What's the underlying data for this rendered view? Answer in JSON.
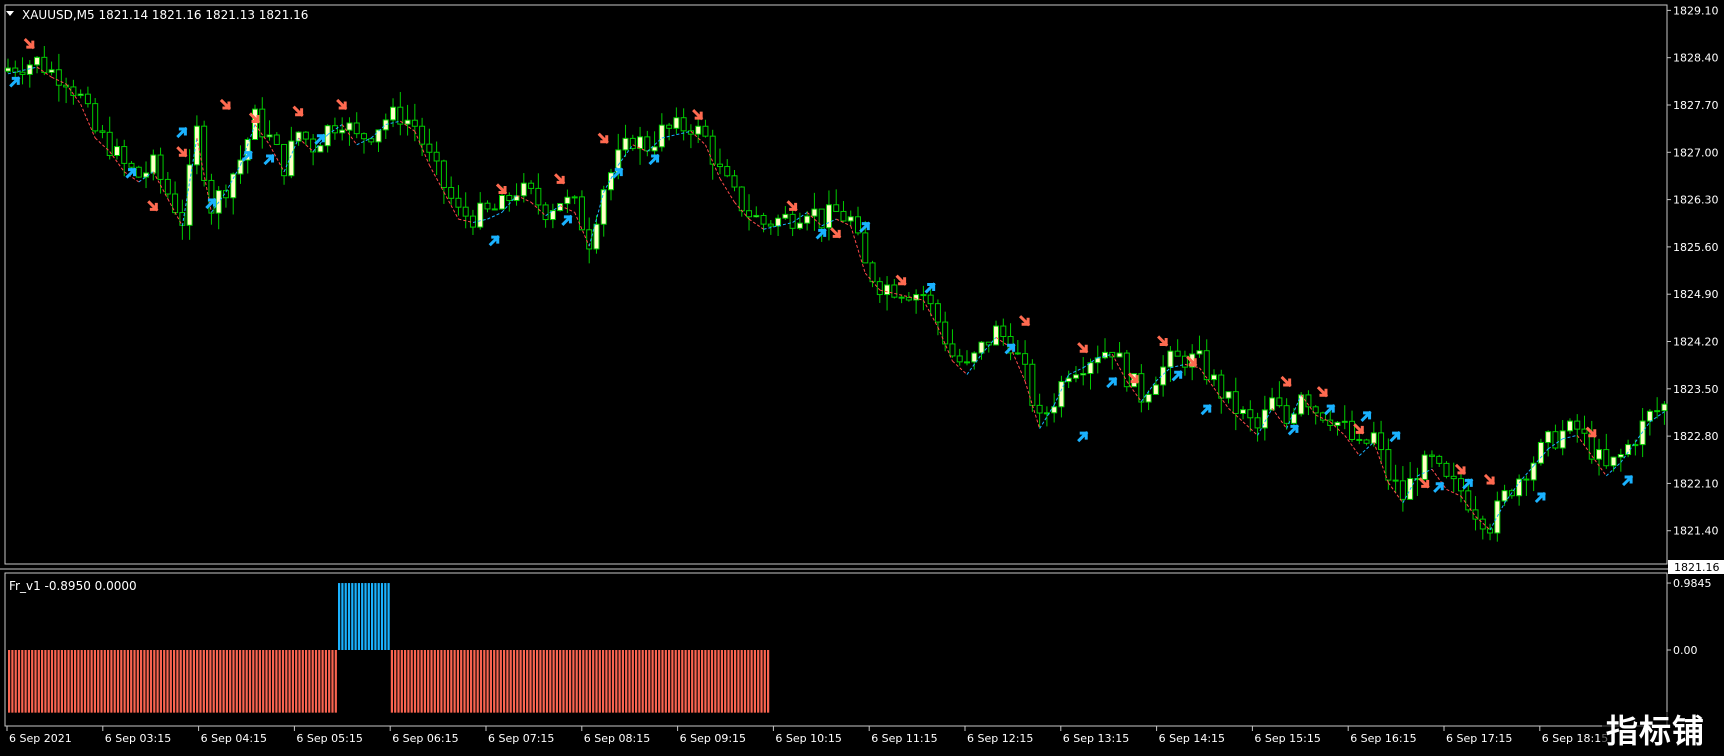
{
  "main_pane": {
    "header": "XAUUSD,M5  1821.14 1821.16 1821.13 1821.16",
    "current_price_label": "1821.16",
    "colors": {
      "bull_fill": "#ffffc8",
      "bull_outline": "#00cc00",
      "bear_fill": "#000000",
      "wick": "#00cc00",
      "arrow_down": "#ff6a50",
      "arrow_up": "#1ab2ff",
      "line_down": "#ff4a4a",
      "line_up": "#1ab2ff"
    }
  },
  "indicator_pane": {
    "header": "Fr_v1 -0.8950 0.0000",
    "colors": {
      "positive": "#1ab2ff",
      "negative": "#fa6450"
    }
  },
  "chart_data": [
    {
      "type": "candlestick",
      "title": "XAUUSD,M5",
      "ylim": [
        1821.1,
        1829.15
      ],
      "y_ticks": [
        "1829.10",
        "1828.40",
        "1827.70",
        "1827.00",
        "1826.30",
        "1825.60",
        "1824.90",
        "1824.20",
        "1823.50",
        "1822.80",
        "1822.10",
        "1821.40"
      ],
      "x_ticks": [
        "6 Sep 2021",
        "6 Sep 03:15",
        "6 Sep 04:15",
        "6 Sep 05:15",
        "6 Sep 06:15",
        "6 Sep 07:15",
        "6 Sep 08:15",
        "6 Sep 09:15",
        "6 Sep 10:15",
        "6 Sep 11:15",
        "6 Sep 12:15",
        "6 Sep 13:15",
        "6 Sep 14:15",
        "6 Sep 15:15",
        "6 Sep 16:15",
        "6 Sep 17:15",
        "6 Sep 18:15"
      ],
      "close_path": [
        [
          0,
          1828.25
        ],
        [
          4,
          1828.35
        ],
        [
          6,
          1828.2
        ],
        [
          8,
          1828.1
        ],
        [
          10,
          1827.8
        ],
        [
          12,
          1827.3
        ],
        [
          14,
          1827.1
        ],
        [
          16,
          1826.8
        ],
        [
          18,
          1826.65
        ],
        [
          20,
          1826.8
        ],
        [
          22,
          1826.4
        ],
        [
          24,
          1826.0
        ],
        [
          26,
          1827.3
        ],
        [
          28,
          1826.2
        ],
        [
          30,
          1826.5
        ],
        [
          32,
          1826.9
        ],
        [
          34,
          1827.5
        ],
        [
          36,
          1827.2
        ],
        [
          38,
          1826.8
        ],
        [
          40,
          1827.3
        ],
        [
          42,
          1827.1
        ],
        [
          44,
          1827.35
        ],
        [
          46,
          1827.5
        ],
        [
          48,
          1827.2
        ],
        [
          50,
          1827.3
        ],
        [
          52,
          1827.5
        ],
        [
          54,
          1827.55
        ],
        [
          56,
          1827.4
        ],
        [
          58,
          1826.9
        ],
        [
          60,
          1826.5
        ],
        [
          62,
          1826.1
        ],
        [
          64,
          1826.05
        ],
        [
          66,
          1826.1
        ],
        [
          68,
          1826.2
        ],
        [
          70,
          1826.45
        ],
        [
          72,
          1826.35
        ],
        [
          74,
          1826.15
        ],
        [
          76,
          1826.3
        ],
        [
          78,
          1826.2
        ],
        [
          80,
          1825.7
        ],
        [
          82,
          1826.5
        ],
        [
          84,
          1826.9
        ],
        [
          86,
          1827.2
        ],
        [
          88,
          1827.1
        ],
        [
          90,
          1827.3
        ],
        [
          92,
          1827.35
        ],
        [
          94,
          1827.4
        ],
        [
          96,
          1827.2
        ],
        [
          98,
          1826.7
        ],
        [
          100,
          1826.35
        ],
        [
          102,
          1826.1
        ],
        [
          104,
          1825.95
        ],
        [
          106,
          1826.0
        ],
        [
          108,
          1826.05
        ],
        [
          110,
          1826.2
        ],
        [
          112,
          1826.0
        ],
        [
          114,
          1826.1
        ],
        [
          116,
          1826.0
        ],
        [
          118,
          1825.3
        ],
        [
          120,
          1825.05
        ],
        [
          122,
          1825.0
        ],
        [
          124,
          1824.95
        ],
        [
          126,
          1824.9
        ],
        [
          128,
          1824.5
        ],
        [
          130,
          1824.0
        ],
        [
          132,
          1823.8
        ],
        [
          134,
          1824.1
        ],
        [
          136,
          1824.35
        ],
        [
          138,
          1824.2
        ],
        [
          140,
          1823.7
        ],
        [
          142,
          1823.0
        ],
        [
          144,
          1823.35
        ],
        [
          146,
          1823.8
        ],
        [
          148,
          1823.9
        ],
        [
          150,
          1824.05
        ],
        [
          152,
          1824.1
        ],
        [
          154,
          1823.7
        ],
        [
          156,
          1823.4
        ],
        [
          158,
          1823.7
        ],
        [
          160,
          1823.9
        ],
        [
          162,
          1823.95
        ],
        [
          164,
          1823.9
        ],
        [
          166,
          1823.6
        ],
        [
          168,
          1823.3
        ],
        [
          170,
          1823.1
        ],
        [
          172,
          1822.9
        ],
        [
          174,
          1823.3
        ],
        [
          176,
          1823.0
        ],
        [
          178,
          1823.5
        ],
        [
          180,
          1823.2
        ],
        [
          182,
          1823.1
        ],
        [
          184,
          1822.9
        ],
        [
          186,
          1822.6
        ],
        [
          188,
          1822.8
        ],
        [
          190,
          1822.2
        ],
        [
          192,
          1821.9
        ],
        [
          194,
          1822.3
        ],
        [
          196,
          1822.4
        ],
        [
          198,
          1822.1
        ],
        [
          200,
          1822.0
        ],
        [
          202,
          1821.7
        ],
        [
          204,
          1821.5
        ],
        [
          206,
          1821.9
        ],
        [
          208,
          1822.2
        ],
        [
          210,
          1822.45
        ],
        [
          212,
          1822.7
        ],
        [
          214,
          1822.85
        ],
        [
          216,
          1822.9
        ],
        [
          218,
          1822.6
        ],
        [
          220,
          1822.3
        ],
        [
          222,
          1822.5
        ],
        [
          224,
          1822.8
        ],
        [
          226,
          1823.1
        ],
        [
          228,
          1823.25
        ]
      ],
      "arrows_down": [
        [
          3,
          1828.6
        ],
        [
          20,
          1826.2
        ],
        [
          24,
          1827.0
        ],
        [
          30,
          1827.7
        ],
        [
          34,
          1827.5
        ],
        [
          40,
          1827.6
        ],
        [
          46,
          1827.7
        ],
        [
          68,
          1826.45
        ],
        [
          76,
          1826.6
        ],
        [
          82,
          1827.2
        ],
        [
          95,
          1827.55
        ],
        [
          108,
          1826.2
        ],
        [
          114,
          1825.8
        ],
        [
          123,
          1825.1
        ],
        [
          140,
          1824.5
        ],
        [
          148,
          1824.1
        ],
        [
          155,
          1823.65
        ],
        [
          159,
          1824.2
        ],
        [
          163,
          1823.9
        ],
        [
          176,
          1823.6
        ],
        [
          181,
          1823.45
        ],
        [
          186,
          1822.9
        ],
        [
          195,
          1822.1
        ],
        [
          200,
          1822.3
        ],
        [
          204,
          1822.15
        ],
        [
          218,
          1822.85
        ]
      ],
      "arrows_up": [
        [
          1,
          1828.05
        ],
        [
          17,
          1826.7
        ],
        [
          24,
          1827.3
        ],
        [
          28,
          1826.25
        ],
        [
          33,
          1826.95
        ],
        [
          36,
          1826.9
        ],
        [
          43,
          1827.2
        ],
        [
          67,
          1825.7
        ],
        [
          77,
          1826.0
        ],
        [
          84,
          1826.7
        ],
        [
          89,
          1826.9
        ],
        [
          112,
          1825.8
        ],
        [
          118,
          1825.9
        ],
        [
          127,
          1825.0
        ],
        [
          138,
          1824.1
        ],
        [
          148,
          1822.8
        ],
        [
          152,
          1823.6
        ],
        [
          161,
          1823.7
        ],
        [
          165,
          1823.2
        ],
        [
          177,
          1822.9
        ],
        [
          182,
          1823.2
        ],
        [
          187,
          1823.1
        ],
        [
          191,
          1822.8
        ],
        [
          197,
          1822.05
        ],
        [
          201,
          1822.1
        ],
        [
          211,
          1821.9
        ],
        [
          223,
          1822.15
        ]
      ]
    },
    {
      "type": "bar",
      "title": "Fr_v1",
      "ylim": [
        -1.0,
        1.0
      ],
      "y_ticks": [
        "0.9845",
        "0.00"
      ],
      "segments": [
        {
          "from": 0,
          "to": 99,
          "value": -0.895
        },
        {
          "from": 100,
          "to": 115,
          "value": 0.9845
        },
        {
          "from": 116,
          "to": 230,
          "value": -0.895
        }
      ]
    }
  ],
  "watermark": "指标铺"
}
